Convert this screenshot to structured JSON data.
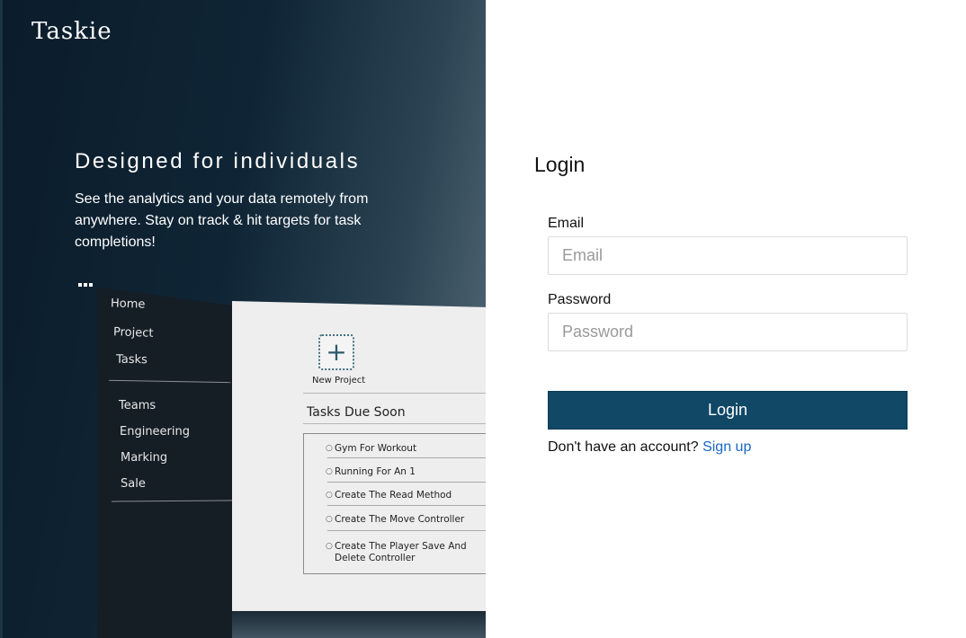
{
  "brand": {
    "name": "Taskie"
  },
  "hero": {
    "title": "Designed for individuals",
    "description": "See the analytics and your data remotely from anywhere. Stay on track & hit targets for task completions!",
    "colors": {
      "panel_dark": "#0b1c2b",
      "panel_light": "#5d717e"
    }
  },
  "mockup": {
    "nav_primary": [
      "Home",
      "Project",
      "Tasks"
    ],
    "nav_teams": [
      "Teams",
      "Engineering",
      "Marking",
      "Sale"
    ],
    "new_project_icon": "plus-icon",
    "new_project_label": "New Project",
    "tasks_title": "Tasks Due Soon",
    "tasks": [
      "Gym For Workout",
      "Running For An 1",
      "Create The Read Method",
      "Create The Move Controller",
      "Create The Player Save And Delete Controller"
    ]
  },
  "login": {
    "title": "Login",
    "email": {
      "label": "Email",
      "placeholder": "Email",
      "value": ""
    },
    "password": {
      "label": "Password",
      "placeholder": "Password",
      "value": ""
    },
    "submit_label": "Login",
    "signup_prompt": "Don't have an account?",
    "signup_link": "Sign up",
    "colors": {
      "button": "#104866",
      "link": "#1a66c4"
    }
  }
}
